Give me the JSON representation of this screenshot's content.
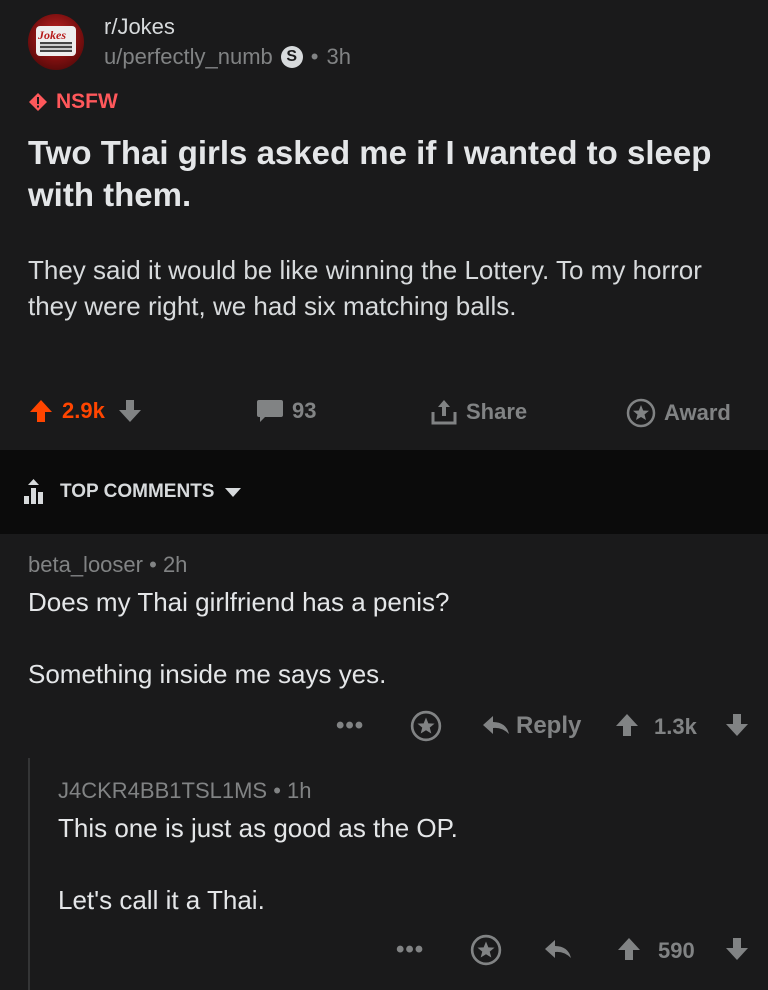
{
  "post": {
    "subreddit": "r/Jokes",
    "author": "u/perfectly_numb",
    "badge": "S",
    "age": "3h",
    "nsfw_label": "NSFW",
    "title": "Two Thai girls asked me if I wanted to sleep with them.",
    "body": "They said it would be like winning the Lottery. To my horror they were right, we had six matching balls.",
    "score": "2.9k",
    "comments": "93",
    "share_label": "Share",
    "award_label": "Award"
  },
  "sort": {
    "label": "TOP COMMENTS"
  },
  "comments": [
    {
      "author": "beta_looser",
      "age": "2h",
      "lines": [
        "Does my Thai girlfriend has a penis?",
        "Something inside me says yes."
      ],
      "reply_label": "Reply",
      "score": "1.3k"
    },
    {
      "author": "J4CKR4BB1TSL1MS",
      "age": "1h",
      "lines": [
        "This one is just as good as the OP.",
        "Let's call it a Thai."
      ],
      "score": "590"
    }
  ],
  "colors": {
    "upvote": "#ff4500",
    "nsfw": "#ff585b",
    "muted": "#818384",
    "background": "#1a1a1b"
  }
}
